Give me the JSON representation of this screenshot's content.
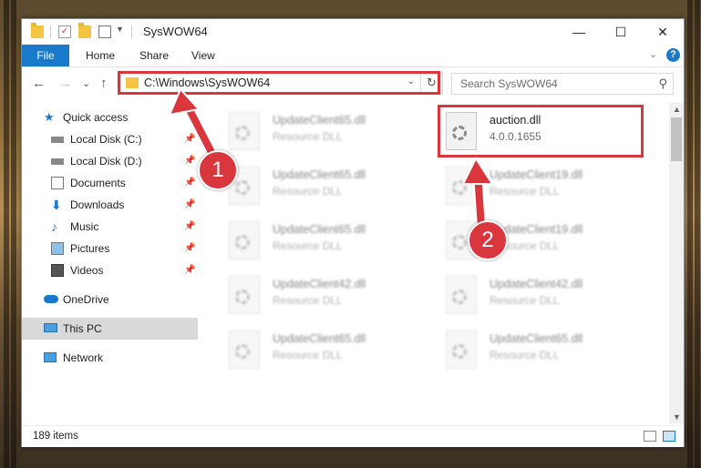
{
  "window": {
    "title": "SysWOW64",
    "controls": {
      "minimize": "—",
      "maximize": "☐",
      "close": "✕"
    }
  },
  "ribbon": {
    "tabs": [
      "File",
      "Home",
      "Share",
      "View"
    ],
    "expand_glyph": "⌄",
    "help_glyph": "?"
  },
  "nav": {
    "back": "←",
    "forward": "→",
    "recent": "⌄",
    "up": "↑",
    "address": "C:\\Windows\\SysWOW64",
    "address_dropdown": "⌄",
    "refresh": "↻",
    "search_placeholder": "Search SysWOW64"
  },
  "sidebar": {
    "items": [
      {
        "label": "Quick access",
        "icon": "star-icon",
        "pinned": false
      },
      {
        "label": "Local Disk (C:)",
        "icon": "drive-icon",
        "pinned": true
      },
      {
        "label": "Local Disk (D:)",
        "icon": "drive-icon",
        "pinned": true
      },
      {
        "label": "Documents",
        "icon": "documents-icon",
        "pinned": true
      },
      {
        "label": "Downloads",
        "icon": "downloads-icon",
        "pinned": true
      },
      {
        "label": "Music",
        "icon": "music-icon",
        "pinned": true
      },
      {
        "label": "Pictures",
        "icon": "pictures-icon",
        "pinned": true
      },
      {
        "label": "Videos",
        "icon": "videos-icon",
        "pinned": true
      },
      {
        "label": "OneDrive",
        "icon": "cloud-icon",
        "pinned": false
      },
      {
        "label": "This PC",
        "icon": "computer-icon",
        "pinned": false,
        "selected": true
      },
      {
        "label": "Network",
        "icon": "network-icon",
        "pinned": false
      }
    ],
    "pin_glyph": "📌"
  },
  "files": [
    {
      "name": "UpdateClient65.dll",
      "type": "Resource DLL",
      "blurred": true
    },
    {
      "name": "auction.dll",
      "type": "4.0.0.1655",
      "blurred": false
    },
    {
      "name": "UpdateClient65.dll",
      "type": "Resource DLL",
      "blurred": true
    },
    {
      "name": "UpdateClient19.dll",
      "type": "Resource DLL",
      "blurred": true
    },
    {
      "name": "UpdateClient65.dll",
      "type": "Resource DLL",
      "blurred": true
    },
    {
      "name": "UpdateClient19.dll",
      "type": "Resource DLL",
      "blurred": true
    },
    {
      "name": "UpdateClient42.dll",
      "type": "Resource DLL",
      "blurred": true
    },
    {
      "name": "UpdateClient42.dll",
      "type": "Resource DLL",
      "blurred": true
    },
    {
      "name": "UpdateClient65.dll",
      "type": "Resource DLL",
      "blurred": true
    },
    {
      "name": "UpdateClient65.dll",
      "type": "Resource DLL",
      "blurred": true
    }
  ],
  "status": {
    "item_count": "189 items"
  },
  "annotations": {
    "badge_1": "1",
    "badge_2": "2",
    "color": "#d9363e"
  },
  "colors": {
    "accent": "#1979ca",
    "folder": "#f4c542"
  }
}
